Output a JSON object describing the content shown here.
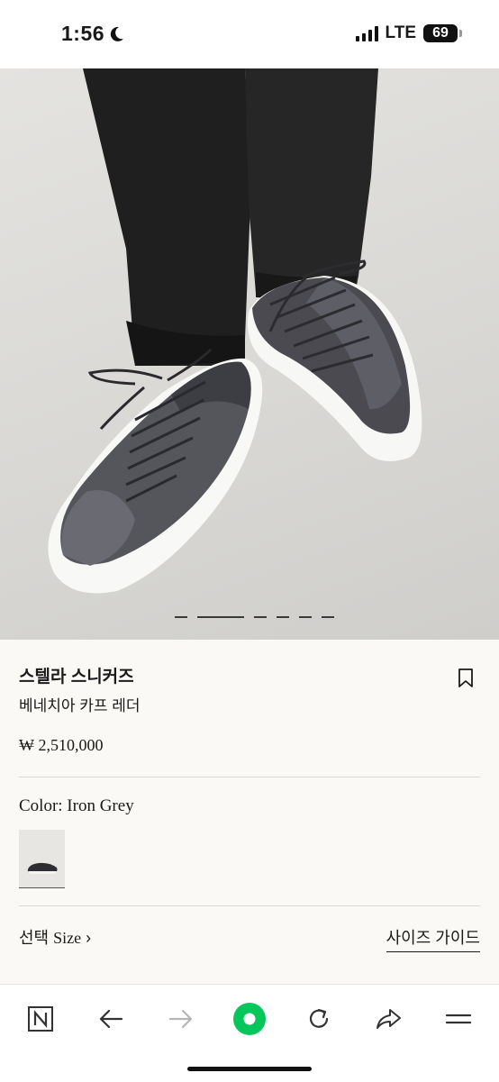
{
  "status_bar": {
    "time": "1:56",
    "network": "LTE",
    "battery": "69"
  },
  "product": {
    "image_alt": "스텔라 스니커즈",
    "title": "스텔라 스니커즈",
    "subtitle": "베네치아 카프 레더",
    "price": "₩ 2,510,000",
    "color_label": "Color: Iron Grey",
    "size_label_ko": "선택",
    "size_label_en": "Size",
    "size_chevron": "›",
    "size_guide": "사이즈 가이드"
  },
  "carousel": {
    "slide_count": 7,
    "active_index": 1
  },
  "toolbar": {
    "items": [
      "naver-n-icon",
      "back-arrow-icon",
      "forward-arrow-icon",
      "home-circle-icon",
      "refresh-icon",
      "share-icon",
      "menu-icon"
    ]
  },
  "colors": {
    "accent_green": "#03c75a",
    "background": "#faf9f6",
    "divider": "#d9d8d4"
  }
}
